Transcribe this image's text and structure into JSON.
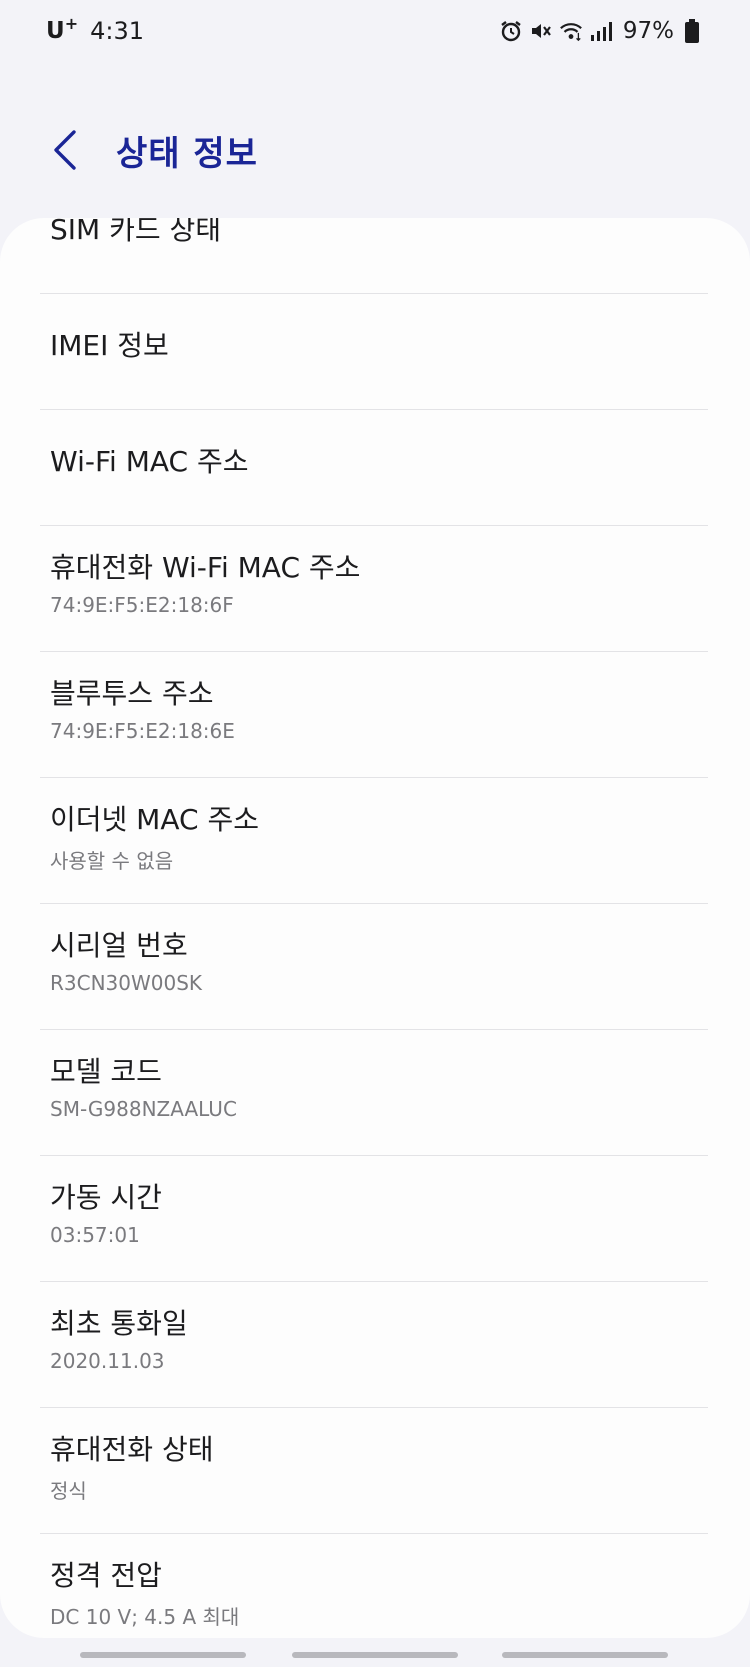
{
  "status_bar": {
    "carrier": "U",
    "carrier_sup": "+",
    "time": "4:31",
    "battery_percent": "97%",
    "icons": [
      "alarm-icon",
      "mute-icon",
      "wifi-icon",
      "signal-icon",
      "battery-icon"
    ]
  },
  "header": {
    "title": "상태 정보",
    "back_icon": "chevron-left-icon"
  },
  "list": {
    "items": [
      {
        "title": "SIM 카드 상태",
        "subtitle": ""
      },
      {
        "title": "IMEI 정보",
        "subtitle": ""
      },
      {
        "title": "Wi-Fi MAC 주소",
        "subtitle": ""
      },
      {
        "title": "휴대전화 Wi-Fi MAC 주소",
        "subtitle": "74:9E:F5:E2:18:6F"
      },
      {
        "title": "블루투스 주소",
        "subtitle": "74:9E:F5:E2:18:6E"
      },
      {
        "title": "이더넷 MAC 주소",
        "subtitle": "사용할 수 없음"
      },
      {
        "title": "시리얼 번호",
        "subtitle": "R3CN30W00SK"
      },
      {
        "title": "모델 코드",
        "subtitle": "SM-G988NZAALUC"
      },
      {
        "title": "가동 시간",
        "subtitle": "03:57:01"
      },
      {
        "title": "최초 통화일",
        "subtitle": "2020.11.03"
      },
      {
        "title": "휴대전화 상태",
        "subtitle": "정식"
      },
      {
        "title": "정격 전압",
        "subtitle": "DC 10 V; 4.5 A 최대"
      }
    ]
  },
  "colors": {
    "background": "#f3f3f8",
    "card": "#fdfdfd",
    "title_accent": "#1a2596",
    "subtitle": "#7a7a7e",
    "divider": "#e3e3e6"
  }
}
